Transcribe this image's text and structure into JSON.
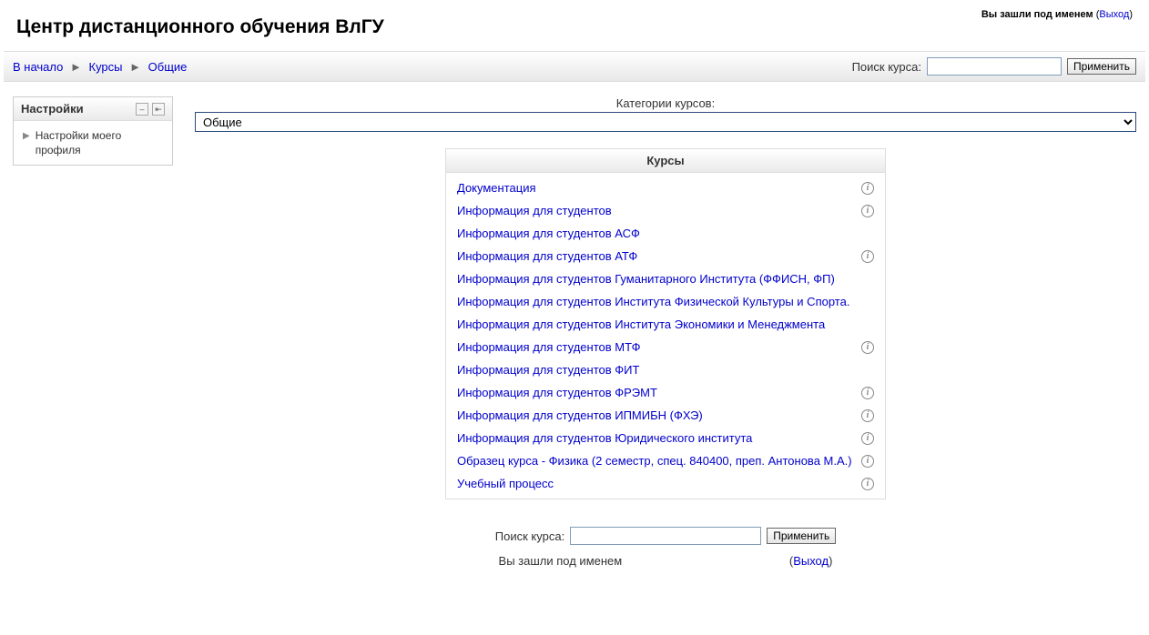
{
  "header": {
    "site_title": "Центр дистанционного обучения ВлГУ",
    "login_text": "Вы зашли под именем",
    "logout_label": "Выход"
  },
  "breadcrumb": {
    "home": "В начало",
    "courses": "Курсы",
    "current": "Общие"
  },
  "search": {
    "label": "Поиск курса:",
    "button": "Применить",
    "value": ""
  },
  "sidebar": {
    "settings_title": "Настройки",
    "profile_settings": "Настройки моего профиля"
  },
  "main": {
    "category_label": "Категории курсов:",
    "category_selected": "Общие",
    "courses_heading": "Курсы",
    "courses": [
      {
        "name": "Документация",
        "info": true
      },
      {
        "name": "Информация для студентов",
        "info": true
      },
      {
        "name": "Информация для студентов АСФ",
        "info": false
      },
      {
        "name": "Информация для студентов АТФ",
        "info": true
      },
      {
        "name": "Информация для студентов Гуманитарного Института (ФФИСН, ФП)",
        "info": false
      },
      {
        "name": "Информация для студентов Института Физической Культуры и Спорта.",
        "info": false
      },
      {
        "name": "Информация для студентов Института Экономики и Менеджмента",
        "info": false
      },
      {
        "name": "Информация для студентов МТФ",
        "info": true
      },
      {
        "name": "Информация для студентов ФИТ",
        "info": false
      },
      {
        "name": "Информация для студентов ФРЭМТ",
        "info": true
      },
      {
        "name": "Информация для студентов ИПМИБН (ФХЭ)",
        "info": true
      },
      {
        "name": "Информация для студентов Юридического института",
        "info": true
      },
      {
        "name": "Образец курса - Физика (2 семестр, спец. 840400, преп. Антонова М.А.)",
        "info": true
      },
      {
        "name": "Учебный процесс",
        "info": true
      }
    ]
  },
  "footer": {
    "login_text": "Вы зашли под именем",
    "logout_label": "Выход"
  }
}
